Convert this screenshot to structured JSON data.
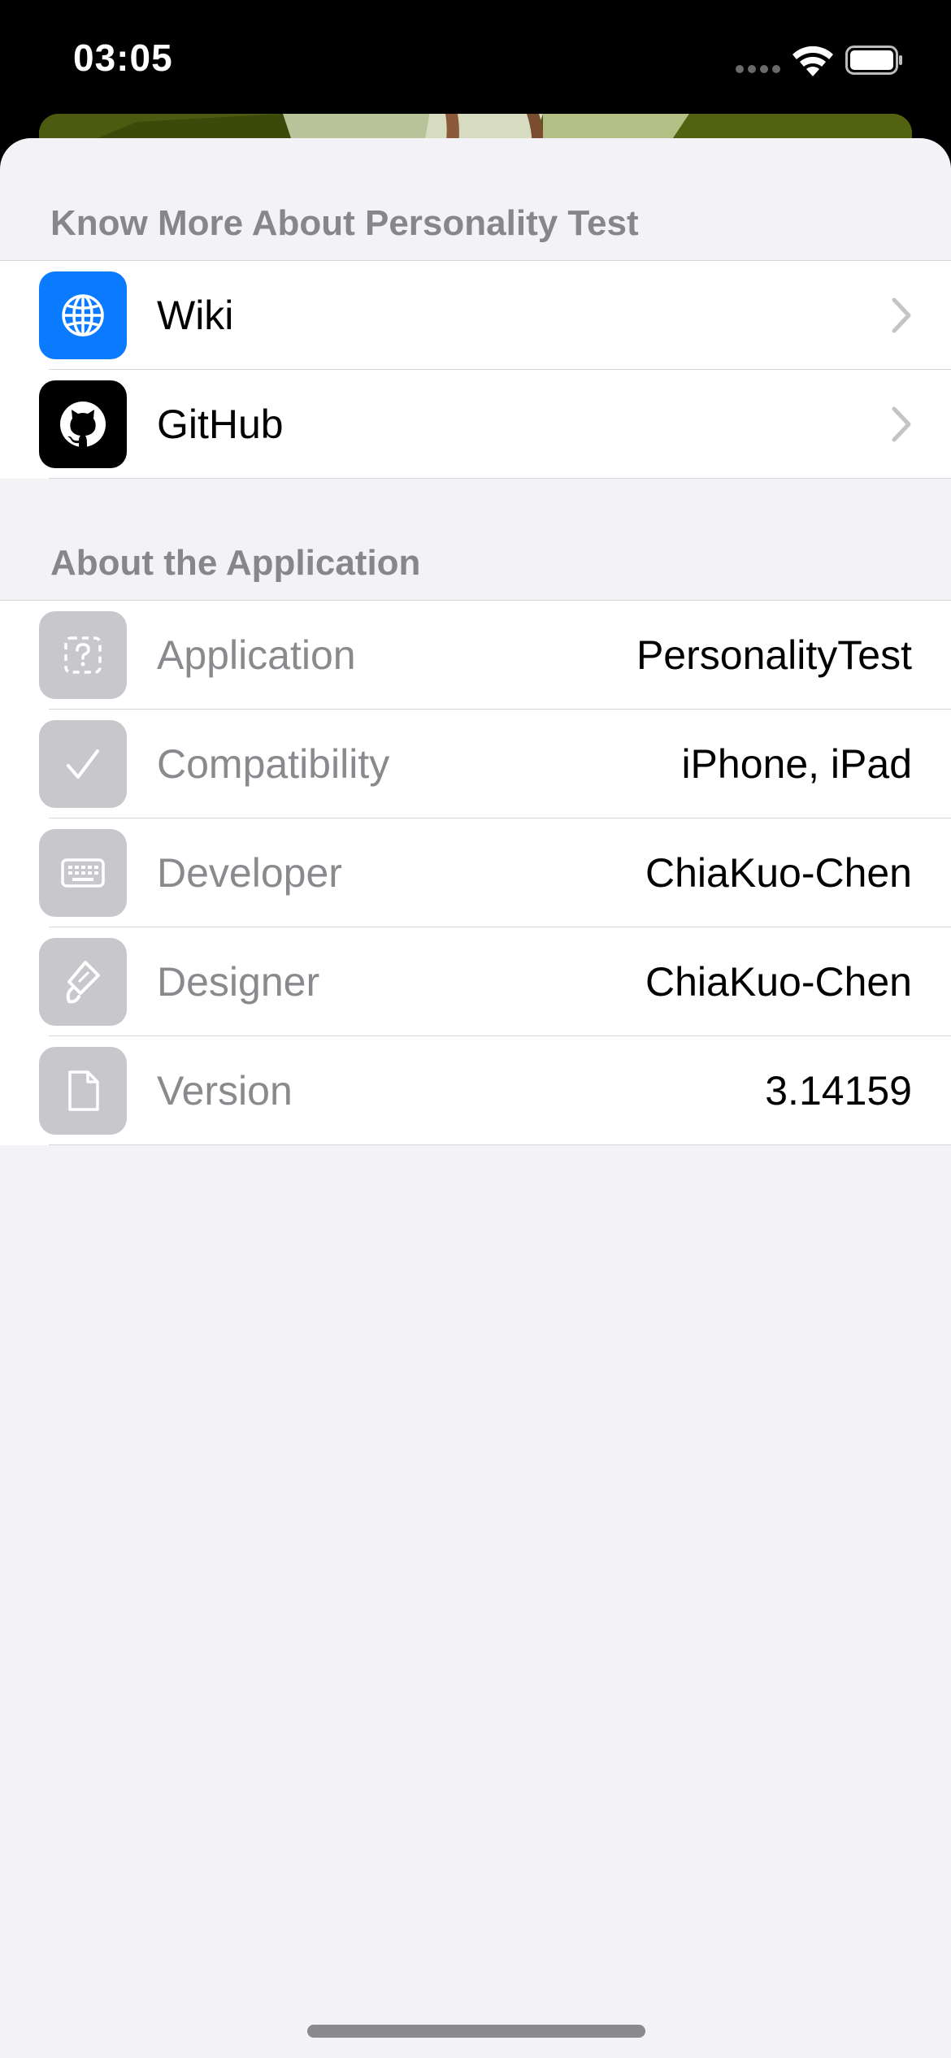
{
  "status_bar": {
    "time": "03:05"
  },
  "sections": {
    "know_more": {
      "header": "Know More About Personality Test",
      "items": [
        {
          "label": "Wiki",
          "icon": "globe-icon",
          "icon_bg": "#0a7aff"
        },
        {
          "label": "GitHub",
          "icon": "github-icon",
          "icon_bg": "#000000"
        }
      ]
    },
    "about_app": {
      "header": "About the Application",
      "items": [
        {
          "label": "Application",
          "value": "PersonalityTest",
          "icon": "app-question-icon"
        },
        {
          "label": "Compatibility",
          "value": "iPhone, iPad",
          "icon": "checkmark-icon"
        },
        {
          "label": "Developer",
          "value": "ChiaKuo-Chen",
          "icon": "keyboard-icon"
        },
        {
          "label": "Designer",
          "value": "ChiaKuo-Chen",
          "icon": "paintbrush-icon"
        },
        {
          "label": "Version",
          "value": "3.14159",
          "icon": "document-icon"
        }
      ]
    }
  },
  "colors": {
    "sheet_background": "#f2f2f7",
    "row_background": "#ffffff",
    "header_text": "#86868b",
    "muted_label": "#8a8a8e",
    "disabled_icon_bg": "#c7c7cc",
    "accent": "#0a7aff"
  }
}
